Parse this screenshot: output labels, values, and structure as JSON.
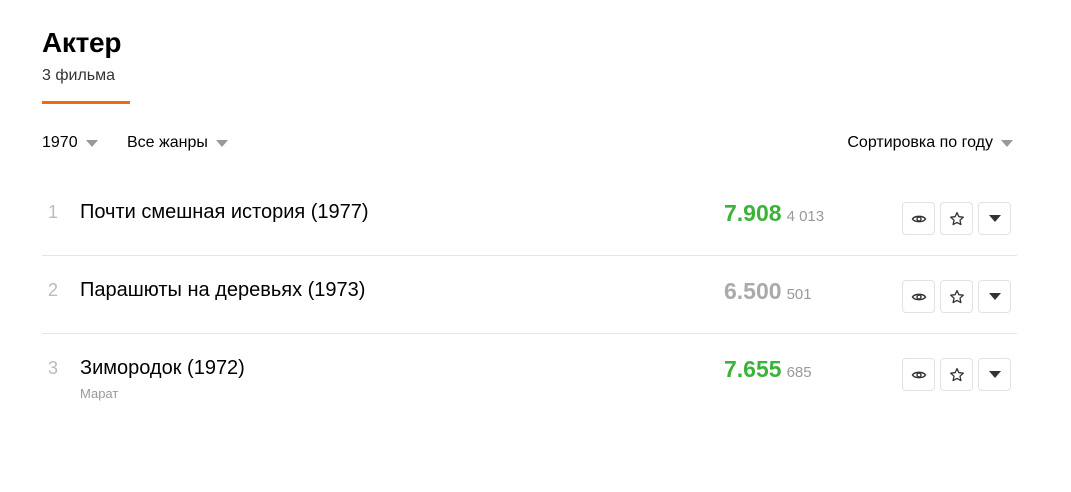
{
  "header": {
    "title": "Актер",
    "count": "3 фильма"
  },
  "filters": {
    "year": "1970",
    "genre": "Все жанры",
    "sort": "Сортировка по году"
  },
  "films": [
    {
      "num": "1",
      "title": "Почти смешная история (1977)",
      "role": "",
      "rating": "7.908",
      "votes": "4 013",
      "rating_color": "#3bb33b"
    },
    {
      "num": "2",
      "title": "Парашюты на деревьях (1973)",
      "role": "",
      "rating": "6.500",
      "votes": "501",
      "rating_color": "#aaaaaa"
    },
    {
      "num": "3",
      "title": "Зимородок (1972)",
      "role": "Марат",
      "rating": "7.655",
      "votes": "685",
      "rating_color": "#3bb33b"
    }
  ],
  "icons": {
    "watched": "eye-icon",
    "favorite": "star-icon",
    "more": "caret-down-icon"
  },
  "accent_color": "#f06b0f"
}
